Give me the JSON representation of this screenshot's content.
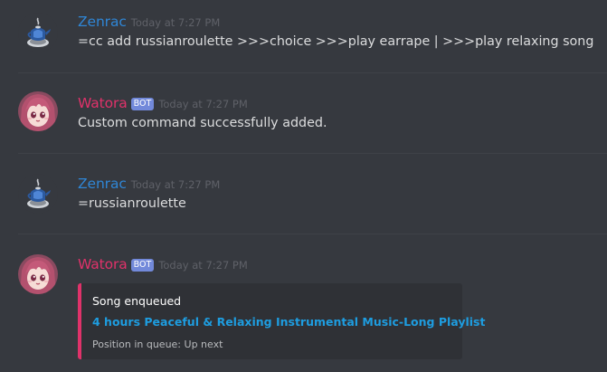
{
  "messages": [
    {
      "username": "Zenrac",
      "timestamp": "Today at 7:27 PM",
      "content": "=cc add russianroulette >>>choice >>>play earrape | >>>play relaxing song",
      "avatar_icon": "teapot-avatar-icon"
    },
    {
      "username": "Watora",
      "bot_tag": "BOT",
      "timestamp": "Today at 7:27 PM",
      "content": "Custom command successfully added.",
      "avatar_icon": "anime-girl-avatar-icon"
    },
    {
      "username": "Zenrac",
      "timestamp": "Today at 7:27 PM",
      "content": "=russianroulette",
      "avatar_icon": "teapot-avatar-icon"
    },
    {
      "username": "Watora",
      "bot_tag": "BOT",
      "timestamp": "Today at 7:27 PM",
      "avatar_icon": "anime-girl-avatar-icon",
      "embed": {
        "author": "Song enqueued",
        "title": "4 hours Peaceful & Relaxing Instrumental Music-Long Playlist",
        "field": "Position in queue: Up next",
        "color": "#e0326a"
      }
    }
  ],
  "colors": {
    "background": "#36393f",
    "user_name": "#2f86d6",
    "bot_name": "#e0326a",
    "bot_tag_bg": "#7289da",
    "link": "#1e9de0"
  }
}
